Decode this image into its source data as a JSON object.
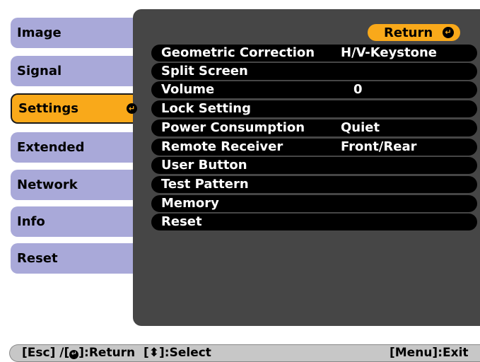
{
  "tabs": [
    {
      "label": "Image"
    },
    {
      "label": "Signal"
    },
    {
      "label": "Settings"
    },
    {
      "label": "Extended"
    },
    {
      "label": "Network"
    },
    {
      "label": "Info"
    },
    {
      "label": "Reset"
    }
  ],
  "active_tab": "Settings",
  "return_label": "Return",
  "rows": [
    {
      "label": "Geometric Correction",
      "value": "H/V-Keystone"
    },
    {
      "label": "Split Screen",
      "value": ""
    },
    {
      "label": "Volume",
      "value": "0"
    },
    {
      "label": "Lock Setting",
      "value": ""
    },
    {
      "label": "Power Consumption",
      "value": "Quiet"
    },
    {
      "label": "Remote Receiver",
      "value": "Front/Rear"
    },
    {
      "label": "User Button",
      "value": ""
    },
    {
      "label": "Test Pattern",
      "value": ""
    },
    {
      "label": "Memory",
      "value": ""
    },
    {
      "label": "Reset",
      "value": ""
    }
  ],
  "footer": {
    "esc_text": "[Esc] /[",
    "return_text": "]:Return",
    "select_open": "[",
    "select_text": "]:Select",
    "exit_text": "[Menu]:Exit"
  },
  "colors": {
    "tab_inactive": "#a9a9d9",
    "tab_active": "#f9a91a",
    "panel": "#464646",
    "row": "#000000",
    "footer": "#c7c7c7"
  },
  "icons": {
    "enter": "enter-icon",
    "updown": "updown-arrow-icon"
  }
}
